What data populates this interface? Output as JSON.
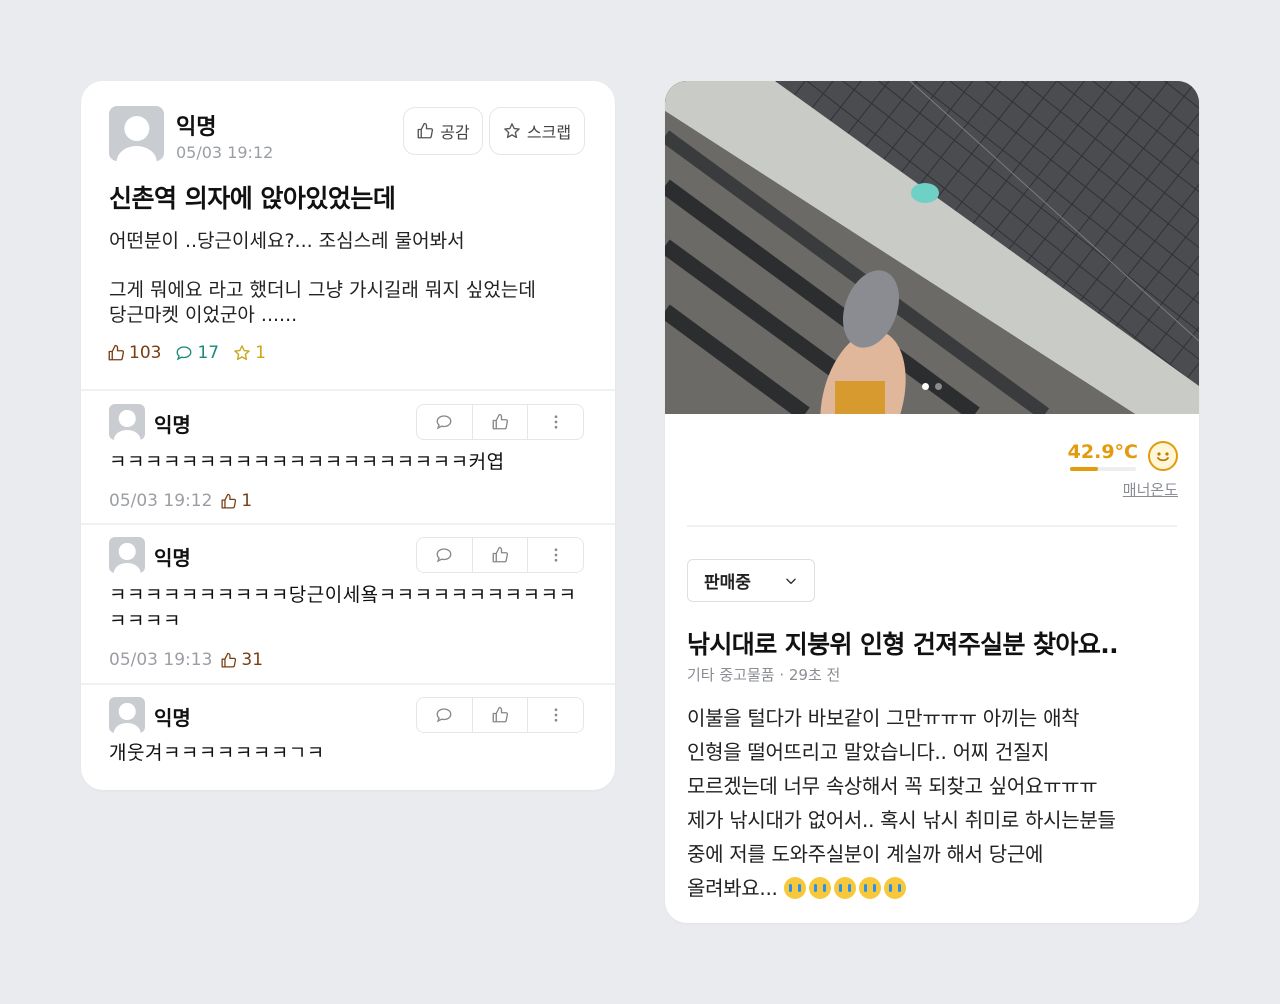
{
  "post": {
    "author": "익명",
    "time": "05/03 19:12",
    "like_button": "공감",
    "scrap_button": "스크랩",
    "title": "신촌역 의자에 앉아있었는데",
    "body_line1": "어떤분이 ..당근이세요?... 조심스레 물어봐서",
    "body_line2": "그게 뭐에요 라고 했더니 그냥 가시길래 뭐지 싶었는데",
    "body_line3": "당근마켓 이었군아 ......",
    "likes": "103",
    "comments": "17",
    "scraps": "1"
  },
  "comments": [
    {
      "author": "익명",
      "text": "ㅋㅋㅋㅋㅋㅋㅋㅋㅋㅋㅋㅋㅋㅋㅋㅋㅋㅋㅋㅋ커엽",
      "time": "05/03 19:12",
      "likes": "1"
    },
    {
      "author": "익명",
      "text": "ㅋㅋㅋㅋㅋㅋㅋㅋㅋㅋ당근이세욬ㅋㅋㅋㅋㅋㅋㅋㅋㅋㅋㅋㅋㅋㅋㅋ",
      "time": "05/03 19:13",
      "likes": "31"
    },
    {
      "author": "익명",
      "text": "개웃겨ㅋㅋㅋㅋㅋㅋㅋㄱㅋ"
    }
  ],
  "listing": {
    "manner_temp": "42.9°C",
    "manner_temp_fraction": 0.43,
    "manner_label": "매너온도",
    "status": "판매중",
    "title": "낚시대로 지붕위 인형 건져주실분 찾아요..",
    "meta": "기타 중고물품 · 29초 전",
    "body_lines": [
      "이불을 털다가 바보같이 그만ㅠㅠㅠ 아끼는 애착",
      "인형을 떨어뜨리고 말았습니다.. 어찌 건질지",
      "모르겠는데 너무 속상해서 꼭 되찾고 싶어요ㅠㅠㅠ",
      "제가 낚시대가 없어서.. 혹시 낚시 취미로 하시는분들",
      "중에 저를 도와주실분이 계실까 해서 당근에",
      "올려봐요..."
    ],
    "emoji_icon": "crying-face-icon",
    "emoji_count": 5,
    "photo_index": 1,
    "photo_count": 2
  },
  "colors": {
    "background": "#e9ebee",
    "like": "#7a3d12",
    "comment": "#1a8a7a",
    "scrap": "#c9a71a",
    "temperature": "#e39b0b"
  }
}
